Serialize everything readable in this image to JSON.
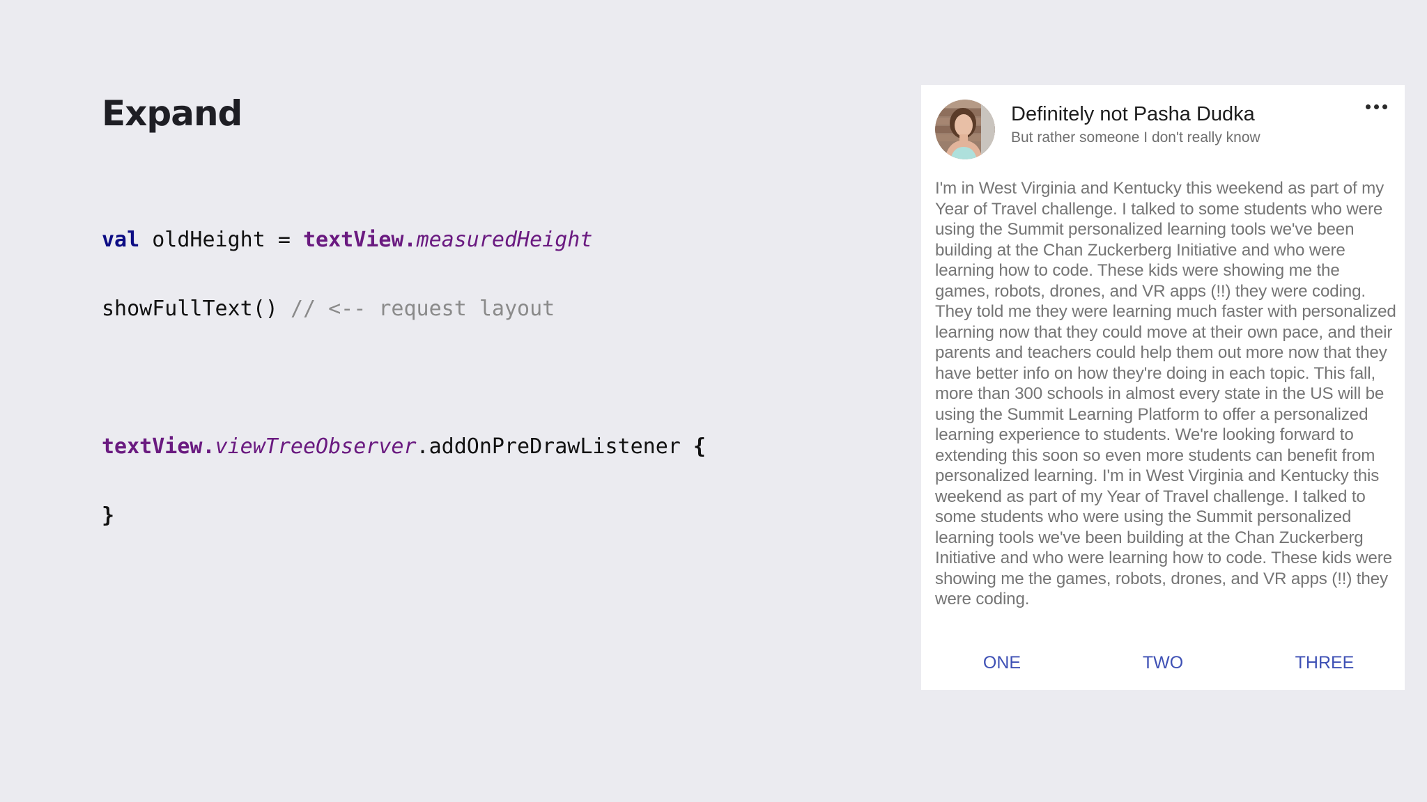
{
  "slide": {
    "title": "Expand"
  },
  "code": {
    "line1": {
      "keyword": "val",
      "variable": " oldHeight = ",
      "object": "textView",
      "dot": ".",
      "property": "measuredHeight"
    },
    "line2": {
      "call": "showFullText() ",
      "comment": "// <-- request layout"
    },
    "line3": {
      "object": "textView",
      "dot": ".",
      "property": "viewTreeObserver",
      "call": ".addOnPreDrawListener ",
      "open_brace": "{"
    },
    "line4": {
      "close_brace": "}"
    }
  },
  "card": {
    "author_name": "Definitely not Pasha Dudka",
    "author_subtitle": "But rather someone I don't really know",
    "avatar_icon": "user-avatar",
    "more_icon": "more-horizontal-icon",
    "body": "I'm in West Virginia and Kentucky this weekend as part of my Year of Travel challenge. I talked to some students who were using the Summit personalized learning tools we've been building at the Chan Zuckerberg Initiative and who were learning how to code. These kids were showing me the games, robots, drones, and VR apps (!!) they were coding. They told me they were learning much faster with personalized learning now that they could move at their own pace, and their parents and teachers could help them out more now that they have better info on how they're doing in each topic. This fall, more than 300 schools in almost every state in the US will be using the Summit Learning Platform to offer a personalized learning experience to students. We're looking forward to extending this soon so even more students can benefit from personalized learning. I'm in West Virginia and Kentucky this weekend as part of my Year of Travel challenge. I talked to some students who were using the Summit personalized learning tools we've been building at the Chan Zuckerberg Initiative and who were learning how to code. These kids were showing me the games, robots, drones, and VR apps (!!) they were coding.",
    "actions": [
      "ONE",
      "TWO",
      "THREE"
    ],
    "accent_color": "#3f51b5"
  }
}
